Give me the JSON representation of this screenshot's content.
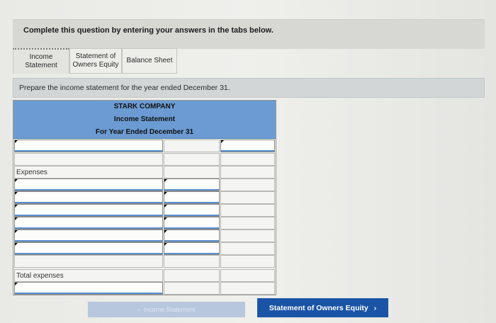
{
  "banner": {
    "text": "Complete this question by entering your answers in the tabs below."
  },
  "tabs": [
    {
      "label": "Income\nStatement",
      "active": true
    },
    {
      "label": "Statement of\nOwners Equity",
      "active": false
    },
    {
      "label": "Balance Sheet",
      "active": false
    }
  ],
  "instruction": "Prepare the income statement for the year ended December 31.",
  "statement": {
    "company": "STARK COMPANY",
    "title": "Income Statement",
    "period": "For Year Ended December 31",
    "expenses_label": "Expenses",
    "total_label": "Total expenses"
  },
  "nav": {
    "prev_label": "Income Statement",
    "prev_icon": "chevron-left-icon",
    "next_label": "Statement of Owners Equity",
    "next_icon": "chevron-right-icon"
  },
  "colors": {
    "header_blue": "#6b9bd2",
    "next_button": "#1a54a6",
    "prev_button_disabled": "#b7c7dd"
  }
}
